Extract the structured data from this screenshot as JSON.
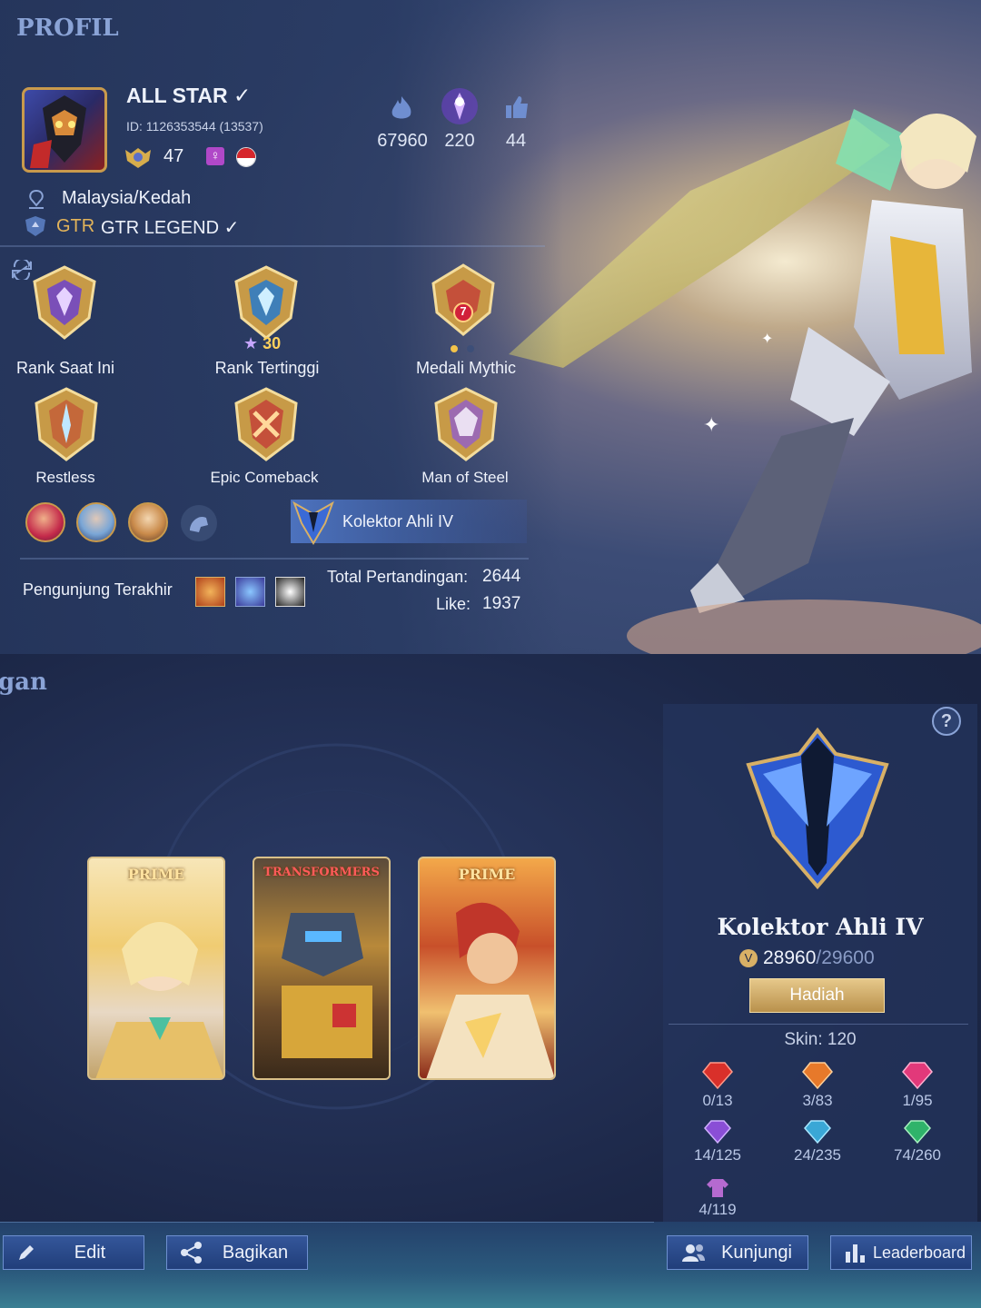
{
  "profile": {
    "section_title": "PROFIL",
    "player_name": "ALL STAR ✓",
    "id_label": "ID:",
    "id_value": "1126353544 (13537)",
    "level": "47",
    "location": "Malaysia/Kedah",
    "squad_tag": "GTR",
    "squad_name": "GTR LEGEND ✓",
    "stats": {
      "popularity": "67960",
      "charisma": "220",
      "likes": "44"
    },
    "medals": [
      {
        "label": "Rank Saat Ini",
        "color": "#c79a47"
      },
      {
        "label": "Rank Tertinggi",
        "color": "#c79a47",
        "stars": "30"
      },
      {
        "label": "Medali Mythic",
        "color": "#c4503a",
        "badge": "7"
      },
      {
        "label": "Restless",
        "color": "#c4683a"
      },
      {
        "label": "Epic Comeback",
        "color": "#c4503a"
      },
      {
        "label": "Man of Steel",
        "color": "#9c6ab0"
      }
    ],
    "collector_banner": "Kolektor Ahli IV",
    "last_visitors_label": "Pengunjung Terakhir",
    "total_matches_label": "Total Pertandingan:",
    "total_matches_value": "2644",
    "like_label": "Like:",
    "like_value": "1937"
  },
  "collection": {
    "section_title_partial": "gan",
    "skins": [
      {
        "tag": "PRIME"
      },
      {
        "tag": "TRANSFORMERS"
      },
      {
        "tag": "PRIME"
      }
    ],
    "help_icon": "?",
    "rank_title": "Kolektor Ahli IV",
    "points_current": "28960",
    "points_total": "/29600",
    "reward_button": "Hadiah",
    "skin_count": "Skin: 120",
    "gems": [
      {
        "value": "0/13",
        "color": "#d9302a"
      },
      {
        "value": "3/83",
        "color": "#e7792a"
      },
      {
        "value": "1/95",
        "color": "#e2397a"
      },
      {
        "value": "14/125",
        "color": "#8a4ed6"
      },
      {
        "value": "24/235",
        "color": "#3aa7d6"
      },
      {
        "value": "74/260",
        "color": "#2fb36a"
      },
      {
        "value": "4/119",
        "color": "#b56ad0"
      }
    ]
  },
  "buttons": {
    "edit": "Edit",
    "share": "Bagikan",
    "visit": "Kunjungi",
    "leaderboard": "Leaderboard"
  }
}
